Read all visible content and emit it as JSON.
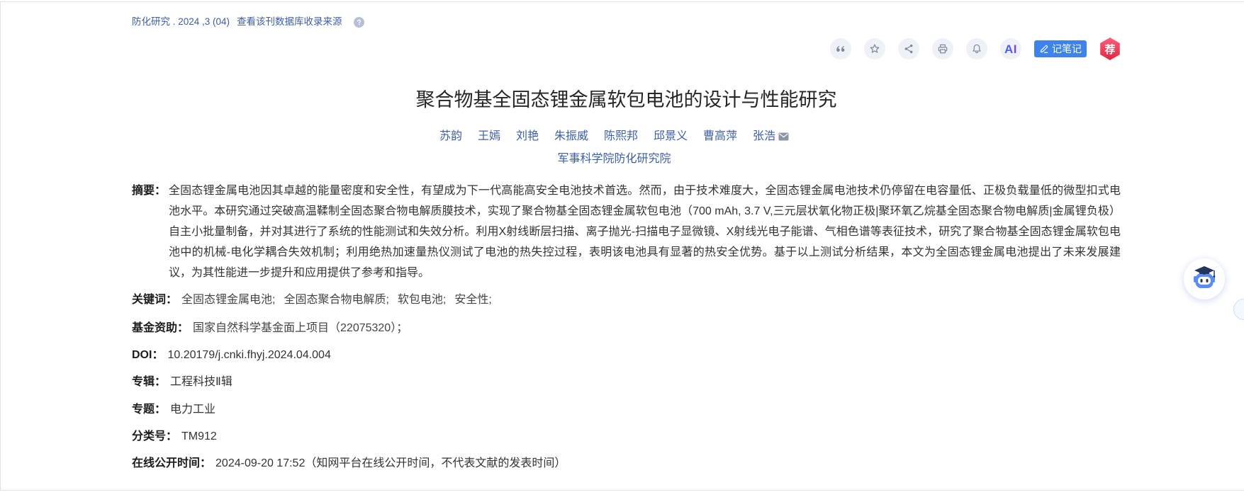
{
  "source": {
    "issue": "防化研究 . 2024 ,3 (04)",
    "db_link": "查看该刊数据库收录来源",
    "help_icon": "question-icon"
  },
  "toolbar": {
    "icons": [
      "quote-icon",
      "star-icon",
      "share-icon",
      "print-icon",
      "bell-icon",
      "pen-icon"
    ],
    "ai_label": "AI",
    "note_label": "记笔记",
    "recommend_label": "荐"
  },
  "title": "聚合物基全固态锂金属软包电池的设计与性能研究",
  "authors": [
    "苏韵",
    "王嫣",
    "刘艳",
    "朱振威",
    "陈熙邦",
    "邱景义",
    "曹高萍",
    "张浩"
  ],
  "corresponding_icon": "mail-icon",
  "institution": "军事科学院防化研究院",
  "abstract": {
    "label": "摘要：",
    "text": "全固态锂金属电池因其卓越的能量密度和安全性，有望成为下一代高能高安全电池技术首选。然而，由于技术难度大，全固态锂金属电池技术仍停留在电容量低、正极负载量低的微型扣式电池水平。本研究通过突破高温鞣制全固态聚合物电解质膜技术，实现了聚合物基全固态锂金属软包电池（700 mAh, 3.7 V,三元层状氧化物正极|聚环氧乙烷基全固态聚合物电解质|金属锂负极）自主小批量制备，并对其进行了系统的性能测试和失效分析。利用X射线断层扫描、离子抛光-扫描电子显微镜、X射线光电子能谱、气相色谱等表征技术，研究了聚合物基全固态锂金属软包电池中的机械-电化学耦合失效机制；利用绝热加速量热仪测试了电池的热失控过程，表明该电池具有显著的热安全优势。基于以上测试分析结果，本文为全固态锂金属电池提出了未来发展建议，为其性能进一步提升和应用提供了参考和指导。"
  },
  "keywords": {
    "label": "关键词：",
    "items": [
      "全固态锂金属电池;",
      "全固态聚合物电解质;",
      "软包电池;",
      "安全性;"
    ]
  },
  "fund": {
    "label": "基金资助：",
    "items": [
      "国家自然科学基金面上项目（22075320）；"
    ]
  },
  "doi": {
    "label": "DOI：",
    "value": "10.20179/j.cnki.fhyj.2024.04.004"
  },
  "album": {
    "label": "专辑：",
    "value": "工程科技Ⅱ辑"
  },
  "topic": {
    "label": "专题：",
    "value": "电力工业"
  },
  "classification": {
    "label": "分类号：",
    "value": "TM912"
  },
  "online_date": {
    "label": "在线公开时间：",
    "value": "2024-09-20 17:52（知网平台在线公开时间，不代表文献的发表时间）"
  },
  "assistant_icon": "robot-icon",
  "colors": {
    "link": "#3d5fa5",
    "label": "#1c1c1c",
    "text": "#333333",
    "muted": "#444444",
    "tool_bg": "#eef1f7",
    "tool_fg": "#7d879c",
    "note_button": "#3d83ea",
    "recommend": "#e4263f",
    "frame": "#e3e3e3"
  }
}
